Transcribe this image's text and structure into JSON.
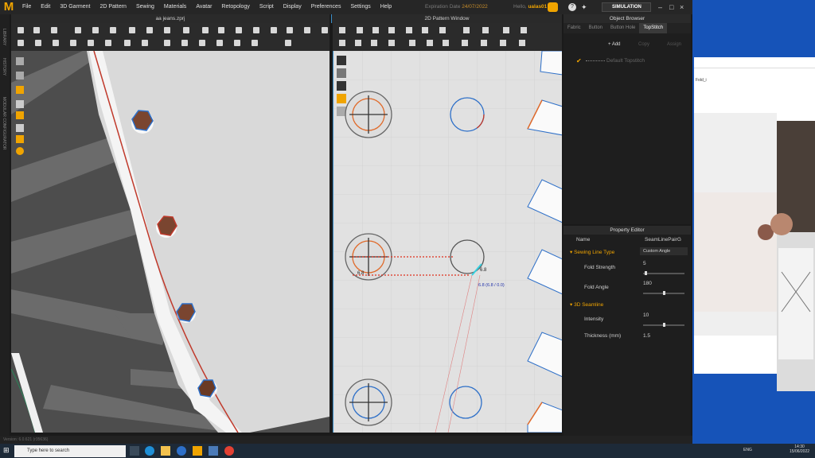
{
  "menubar": {
    "logo": "M",
    "items": [
      "File",
      "Edit",
      "3D Garment",
      "2D Pattern",
      "Sewing",
      "Materials",
      "Avatar",
      "Retopology",
      "Script",
      "Display",
      "Preferences",
      "Settings",
      "Help"
    ],
    "expiry_label": "Expiration Date",
    "expiry_date": "24/07/2022",
    "hello_label": "Hello,",
    "username": "ualas01",
    "simulation": "SIMULATION"
  },
  "left_strip": [
    "LIBRARY",
    "HISTORY",
    "MODULAR CONFIGURATOR"
  ],
  "viewport3d": {
    "title": "aa jeans.zprj"
  },
  "pattern_window": {
    "title": "2D Pattern Window",
    "labels": [
      "6.8",
      "6.8",
      "6.8 (6.8 / 0.0)"
    ]
  },
  "object_browser": {
    "title": "Object Browser",
    "tabs": [
      "Fabric",
      "Button",
      "Button Hole",
      "TopStitch"
    ],
    "active_tab": "TopStitch",
    "add": "+ Add",
    "copy": "Copy",
    "assign": "Assign",
    "item": "Default Topstitch"
  },
  "property_editor": {
    "title": "Property Editor",
    "name_label": "Name",
    "name_value": "SeamLinePairG",
    "section1": "Sewing Line Type",
    "section1_value": "Custom Angle",
    "fold_strength_label": "Fold Strength",
    "fold_strength": "5",
    "fold_angle_label": "Fold Angle",
    "fold_angle": "180",
    "section2": "3D Seamline",
    "intensity_label": "Intensity",
    "intensity": "10",
    "thickness_label": "Thickness (mm)",
    "thickness": "1.5"
  },
  "statusbar": {
    "version": "Version: 6.0.621 (r35636)"
  },
  "external_window": {
    "path": "Fold_i"
  },
  "taskbar": {
    "search_placeholder": "Type here to search",
    "time": "14:30",
    "date": "15/06/2022",
    "lang": "ENG"
  },
  "colors": {
    "accent": "#f0a400",
    "selection": "#3a8ec9",
    "seam_red": "#e0301e"
  }
}
